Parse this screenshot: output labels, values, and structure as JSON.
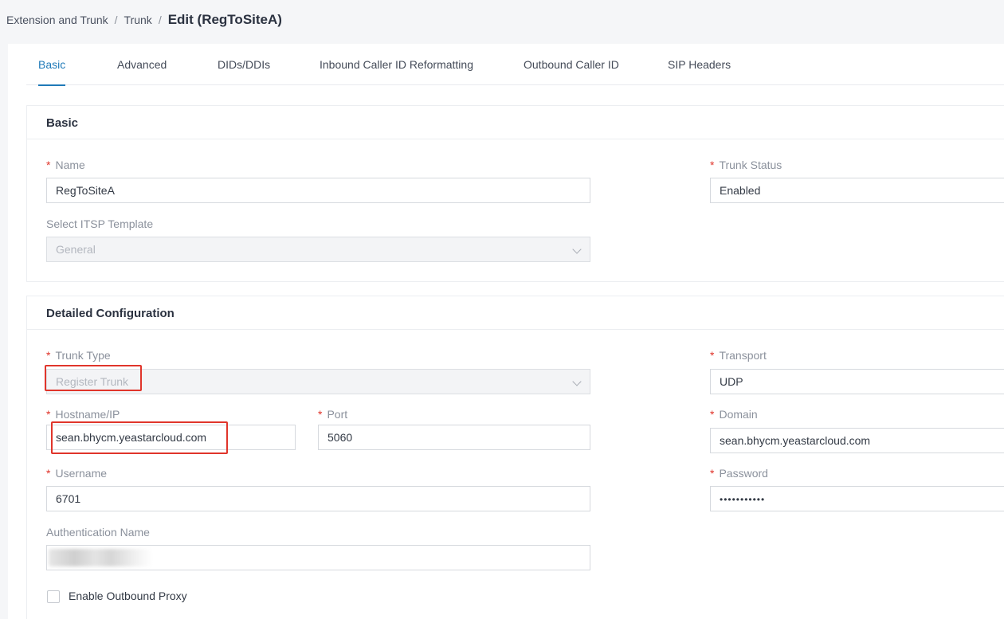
{
  "breadcrumb": {
    "item1": "Extension and Trunk",
    "separator": "/",
    "item2": "Trunk",
    "current": "Edit (RegToSiteA)"
  },
  "tabs": [
    {
      "label": "Basic",
      "active": true
    },
    {
      "label": "Advanced",
      "active": false
    },
    {
      "label": "DIDs/DDIs",
      "active": false
    },
    {
      "label": "Inbound Caller ID Reformatting",
      "active": false
    },
    {
      "label": "Outbound Caller ID",
      "active": false
    },
    {
      "label": "SIP Headers",
      "active": false
    }
  ],
  "required_marker": "*",
  "basic": {
    "title": "Basic",
    "name_label": "Name",
    "name_value": "RegToSiteA",
    "trunk_status_label": "Trunk Status",
    "trunk_status_value": "Enabled",
    "itsp_template_label": "Select ITSP Template",
    "itsp_template_value": "General"
  },
  "detailed": {
    "title": "Detailed Configuration",
    "trunk_type_label": "Trunk Type",
    "trunk_type_value": "Register Trunk",
    "transport_label": "Transport",
    "transport_value": "UDP",
    "hostname_label": "Hostname/IP",
    "hostname_value": "sean.bhycm.yeastarcloud.com",
    "port_label": "Port",
    "port_value": "5060",
    "domain_label": "Domain",
    "domain_value": "sean.bhycm.yeastarcloud.com",
    "username_label": "Username",
    "username_value": "6701",
    "password_label": "Password",
    "password_value": "•••••••••••",
    "auth_name_label": "Authentication Name",
    "outbound_proxy_label": "Enable Outbound Proxy",
    "outbound_proxy_checked": false
  },
  "colors": {
    "accent": "#1f7ab8",
    "required": "#e0352b",
    "highlight_box": "#e0352b"
  }
}
